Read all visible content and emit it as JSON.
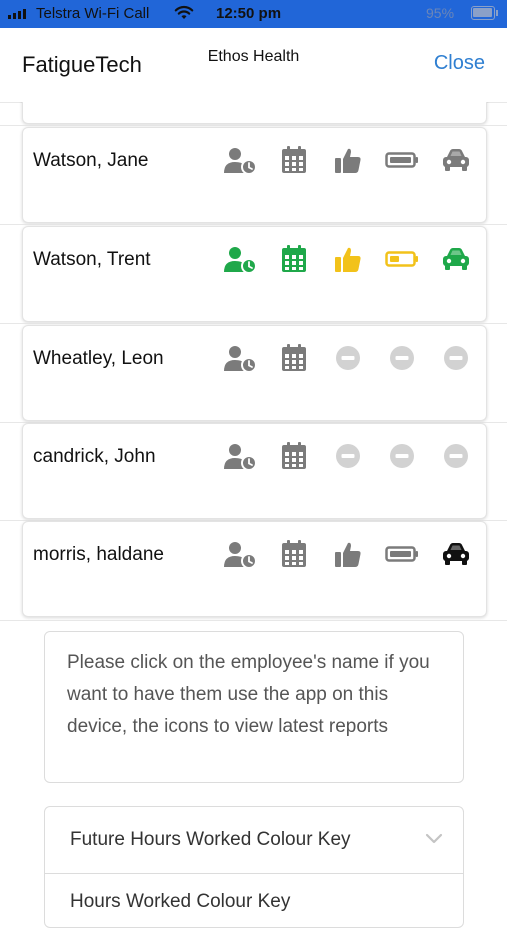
{
  "status_bar": {
    "carrier": "Telstra Wi-Fi Call",
    "time": "12:50 pm",
    "battery": "95%"
  },
  "header": {
    "app_title": "FatigueTech",
    "org_name": "Ethos Health",
    "close_label": "Close"
  },
  "employees": [
    {
      "name": "Watson, Jane",
      "icons": [
        "grey",
        "grey",
        "grey",
        "grey",
        "grey"
      ]
    },
    {
      "name": "Watson, Trent",
      "icons": [
        "green",
        "green",
        "yellow",
        "yellow",
        "green"
      ]
    },
    {
      "name": "Wheatley, Leon",
      "icons": [
        "grey",
        "grey",
        "disabled",
        "disabled",
        "disabled"
      ]
    },
    {
      "name": "candrick, John",
      "icons": [
        "grey",
        "grey",
        "disabled",
        "disabled",
        "disabled"
      ]
    },
    {
      "name": "morris, haldane",
      "icons": [
        "grey",
        "grey",
        "grey",
        "grey",
        "black"
      ]
    }
  ],
  "icon_names": [
    "person-clock-icon",
    "calendar-icon",
    "thumbs-up-icon",
    "battery-icon",
    "car-icon"
  ],
  "colors": {
    "grey": "#7b7b7b",
    "green": "#1fa84a",
    "yellow": "#f2c21a",
    "black": "#111111",
    "disabled": "#d2d2d2",
    "link": "#2f7fd1"
  },
  "info_text": "Please click on the employee's name if you want to have them use the app on this device, the icons to view latest reports",
  "accordion": {
    "title": "Future Hours Worked Colour Key",
    "subtitle": "Hours Worked Colour Key"
  }
}
